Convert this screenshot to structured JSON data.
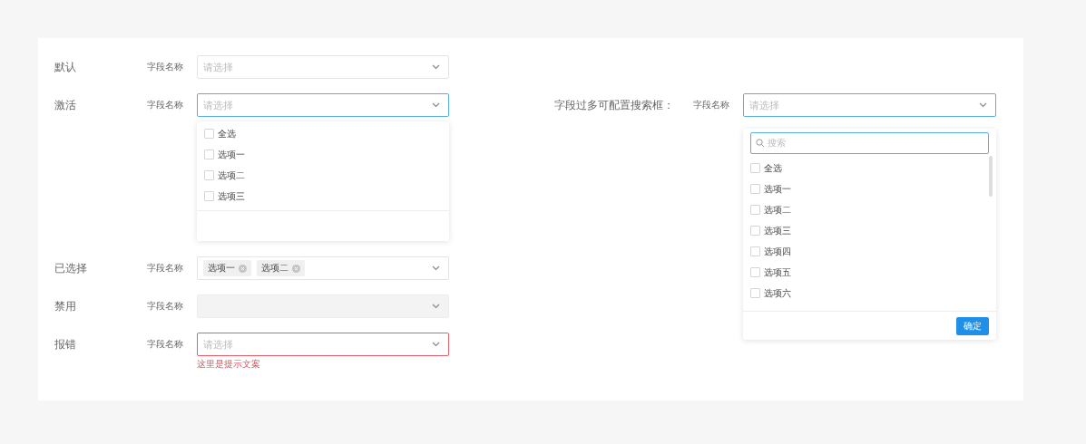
{
  "left_rows": [
    {
      "kind": "default",
      "label": "默认",
      "field_label": "字段名称",
      "placeholder": "请选择",
      "focused": false
    },
    {
      "kind": "open",
      "label": "激活",
      "field_label": "字段名称",
      "placeholder": "请选择",
      "focused": true,
      "options": [
        {
          "label": "全选",
          "checked": false
        },
        {
          "label": "选项一",
          "checked": false
        },
        {
          "label": "选项二",
          "checked": false
        },
        {
          "label": "选项三",
          "checked": false
        }
      ]
    },
    {
      "kind": "tags",
      "label": "已选择",
      "field_label": "字段名称",
      "focused": false,
      "tags": [
        "选项一",
        "选项二"
      ]
    },
    {
      "kind": "disabled",
      "label": "禁用",
      "field_label": "字段名称",
      "disabled": true,
      "focused": false
    },
    {
      "kind": "error",
      "label": "报错",
      "field_label": "字段名称",
      "placeholder": "请选择",
      "focused": false,
      "error": "这里是提示文案"
    }
  ],
  "search_select": {
    "label": "字段过多可配置搜索框：",
    "field_label": "字段名称",
    "placeholder": "请选择",
    "focused": true,
    "search_placeholder": "搜索",
    "options": [
      {
        "label": "全选",
        "checked": false
      },
      {
        "label": "选项一",
        "checked": false
      },
      {
        "label": "选项二",
        "checked": false
      },
      {
        "label": "选项三",
        "checked": false
      },
      {
        "label": "选项四",
        "checked": false
      },
      {
        "label": "选项五",
        "checked": false
      },
      {
        "label": "选项六",
        "checked": false
      }
    ],
    "confirm": "确定"
  }
}
